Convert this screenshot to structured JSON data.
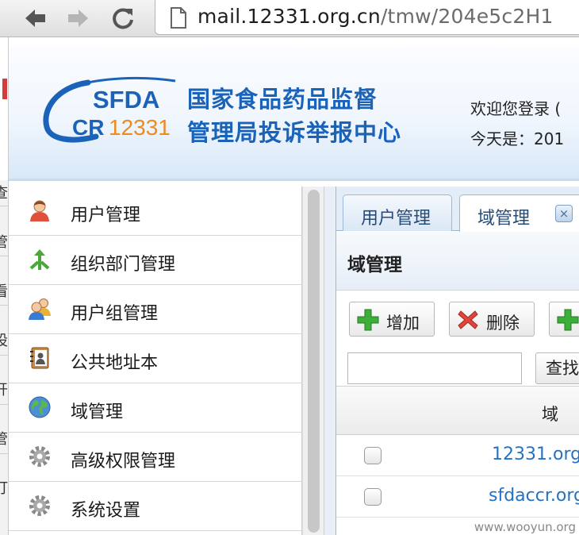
{
  "browser": {
    "url_host": "mail.12331.org.cn",
    "url_rest": "/tmw/204e5c2H1"
  },
  "banner": {
    "logo_top": "SFDA",
    "logo_bottom_a": "CR",
    "logo_bottom_b": "12331",
    "title_line1": "国家食品药品监督",
    "title_line2": "管理局投诉举报中心",
    "welcome_line1": "欢迎您登录 (",
    "welcome_line2": "今天是：201"
  },
  "left_strip": [
    "查",
    "管",
    "看",
    "设",
    "开",
    "管",
    "打"
  ],
  "sidebar": {
    "items": [
      {
        "label": "用户管理",
        "icon": "user-icon"
      },
      {
        "label": "组织部门管理",
        "icon": "org-tree-icon"
      },
      {
        "label": "用户组管理",
        "icon": "user-group-icon"
      },
      {
        "label": "公共地址本",
        "icon": "address-book-icon"
      },
      {
        "label": "域管理",
        "icon": "globe-icon"
      },
      {
        "label": "高级权限管理",
        "icon": "gear-icon"
      },
      {
        "label": "系统设置",
        "icon": "gear-icon"
      }
    ]
  },
  "tabs": [
    {
      "label": "用户管理",
      "active": false
    },
    {
      "label": "域管理",
      "active": true,
      "close": "×"
    }
  ],
  "panel": {
    "title": "域管理"
  },
  "toolbar": {
    "add_label": "增加",
    "delete_label": "删除",
    "search_label": "查找",
    "search_placeholder": ""
  },
  "grid": {
    "column_header": "域",
    "rows": [
      {
        "domain": "12331.org"
      },
      {
        "domain": "sfdaccr.org"
      }
    ]
  },
  "watermark": "www.wooyun.org",
  "colors": {
    "brand_blue": "#1b63b8",
    "logo_orange": "#f08a1c",
    "link_blue": "#2672c0"
  }
}
